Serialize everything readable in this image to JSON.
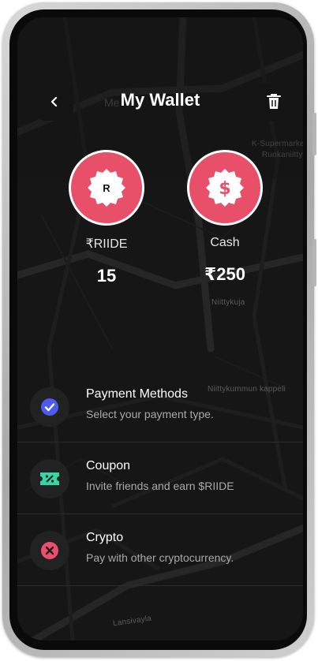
{
  "header": {
    "title": "My Wallet",
    "ghost_text": "Me",
    "back_icon": "chevron-left-icon",
    "trash_icon": "trash-icon"
  },
  "balances": [
    {
      "label": "₹RIIDE",
      "value": "15",
      "coin_letter": "R",
      "icon": "riide-coin-icon"
    },
    {
      "label": "Cash",
      "value": "₹250",
      "icon": "dollar-coin-icon"
    }
  ],
  "menu": [
    {
      "title": "Payment Methods",
      "subtitle": "Select your payment type.",
      "icon": "check-circle-icon",
      "icon_color": "#4c5cf0"
    },
    {
      "title": "Coupon",
      "subtitle": "Invite friends and earn $RIIDE",
      "icon": "ticket-percent-icon",
      "icon_color": "#34d6a8"
    },
    {
      "title": "Crypto",
      "subtitle": "Pay with other cryptocurrency.",
      "icon": "x-circle-icon",
      "icon_color": "#ee4d6e"
    }
  ],
  "map_labels": {
    "l1": "K-Supermarket",
    "l2": "Ruokaniitty",
    "l3": "Niittykuja",
    "l4": "Niittykummun kappeli",
    "l5": "Lansivayla"
  },
  "colors": {
    "accent": "#e8506a",
    "background": "#161616"
  }
}
